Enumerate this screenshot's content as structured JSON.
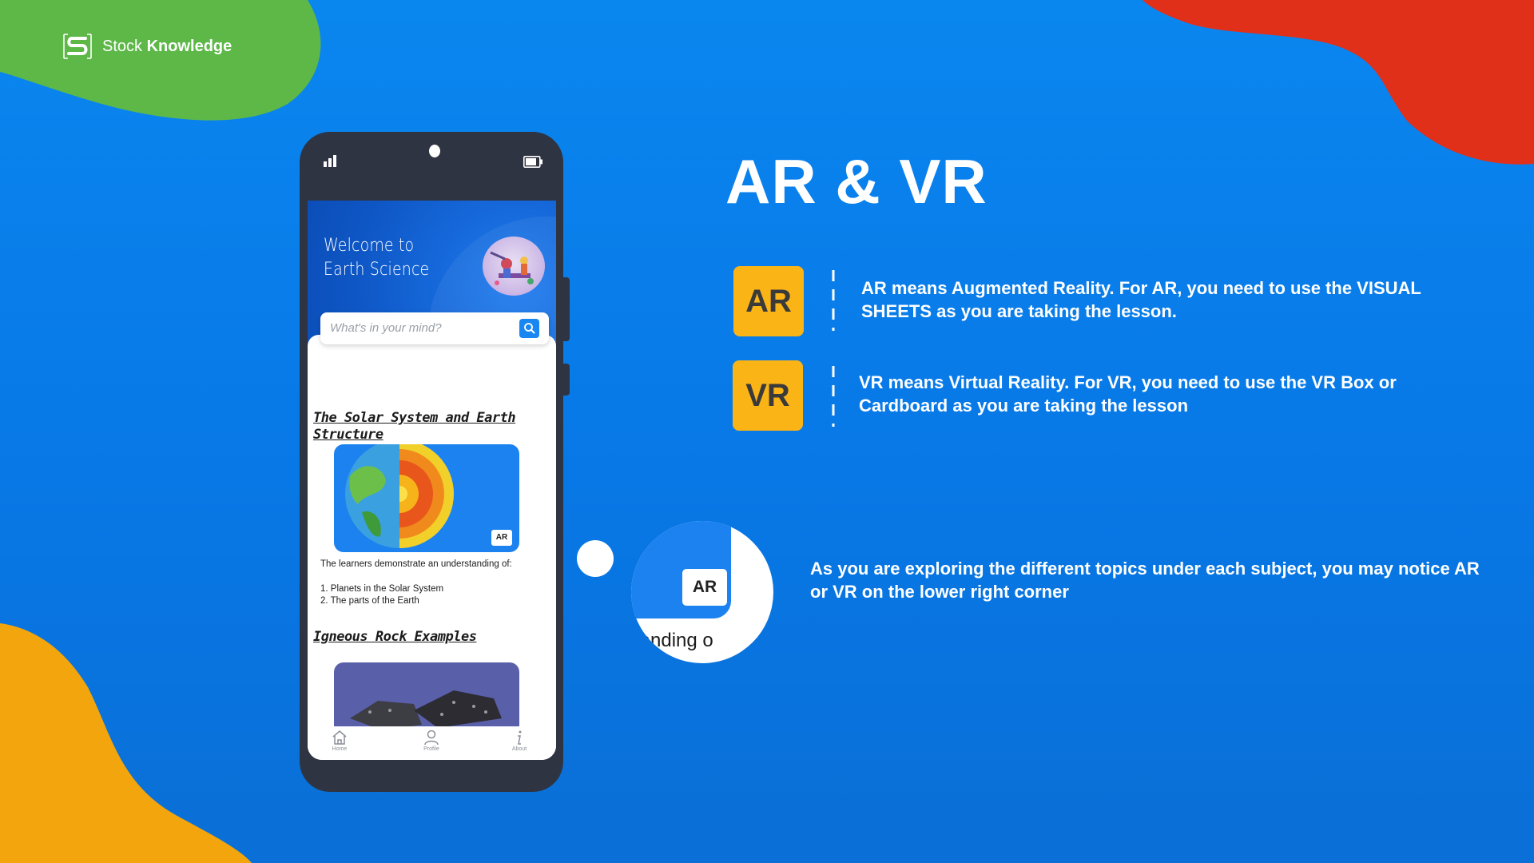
{
  "brand": {
    "name_regular": "Stock",
    "name_bold": "Knowledge"
  },
  "phone": {
    "welcome_line1": "Welcome to",
    "welcome_line2": "Earth Science",
    "search_placeholder": "What's in your mind?",
    "topics": [
      {
        "title": "The Solar System and Earth Structure",
        "badge": "AR",
        "intro": "The learners demonstrate an understanding of:",
        "items": [
          "1. Planets in the Solar System",
          "2. The parts of the Earth"
        ]
      },
      {
        "title": "Igneous Rock Examples"
      }
    ],
    "nav": {
      "home": "Home",
      "profile": "Profile",
      "about": "About"
    }
  },
  "slide": {
    "title": "AR & VR",
    "ar": {
      "tile": "AR",
      "text": "AR means Augmented Reality. For AR, you need to use the VISUAL SHEETS as you are taking the lesson."
    },
    "vr": {
      "tile": "VR",
      "text": "VR means Virtual Reality. For VR, you need to use the VR Box or Cardboard as you are taking the lesson"
    },
    "zoom_badge": "AR",
    "zoom_text": "rstanding o",
    "note": "As you are exploring the different topics under each subject, you may notice AR or VR on the lower right corner"
  },
  "colors": {
    "background": "#0a86ef",
    "tile": "#fbb416",
    "green_blob": "#5db848",
    "red_blob": "#e0301a",
    "orange_blob": "#f2a50c",
    "phone_frame": "#2f3442"
  }
}
